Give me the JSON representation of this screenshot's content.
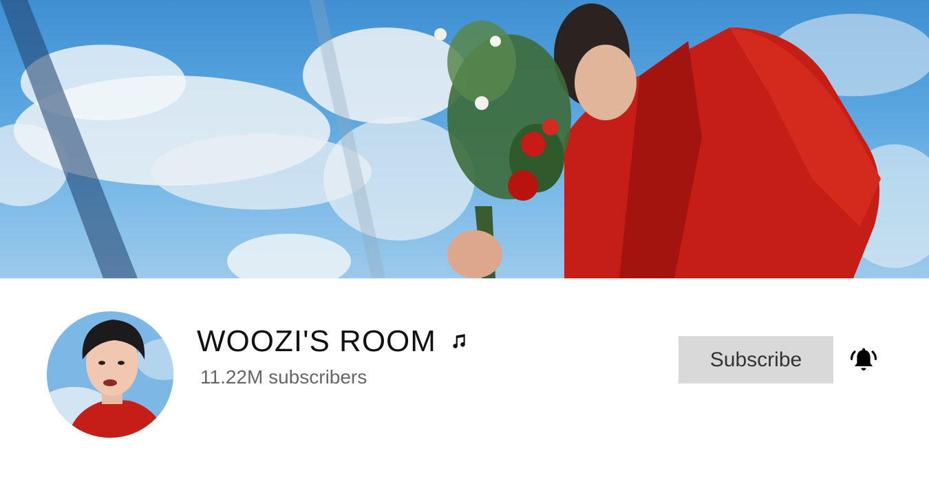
{
  "channel": {
    "name": "WOOZI'S ROOM",
    "subscribers": "11.22M subscribers"
  },
  "actions": {
    "subscribe_label": "Subscribe"
  },
  "icons": {
    "music": "music-note-icon",
    "bell": "bell-ring-icon"
  },
  "colors": {
    "sky_blue": "#4a98d8",
    "jacket_red": "#c41e16",
    "button_gray": "#d9d9d9"
  }
}
